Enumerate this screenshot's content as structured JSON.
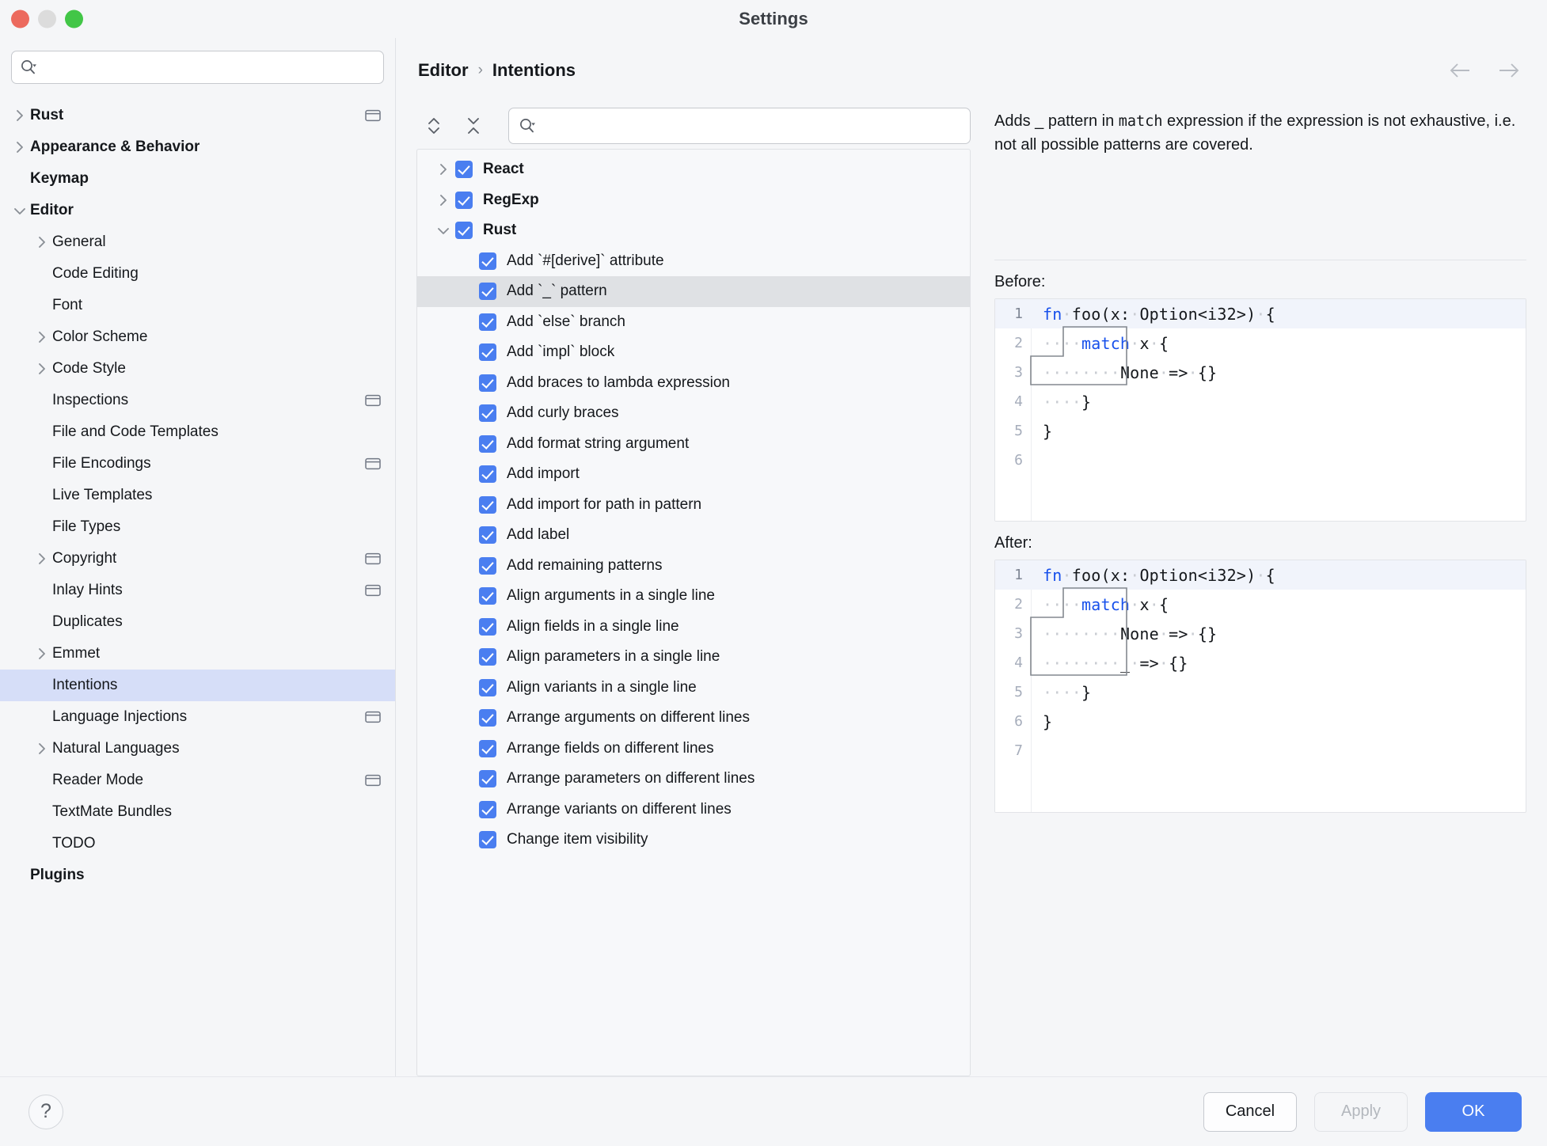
{
  "window": {
    "title": "Settings",
    "traffic_lights": [
      "close",
      "minimize",
      "zoom"
    ]
  },
  "sidebar": {
    "search": {
      "value": "",
      "placeholder": ""
    },
    "items": [
      {
        "label": "Rust",
        "indent": 0,
        "bold": true,
        "chevron": "right",
        "badge": true
      },
      {
        "label": "Appearance & Behavior",
        "indent": 0,
        "bold": true,
        "chevron": "right",
        "badge": false
      },
      {
        "label": "Keymap",
        "indent": 0,
        "bold": true,
        "chevron": "none",
        "badge": false
      },
      {
        "label": "Editor",
        "indent": 0,
        "bold": true,
        "chevron": "down",
        "badge": false
      },
      {
        "label": "General",
        "indent": 1,
        "bold": false,
        "chevron": "right",
        "badge": false
      },
      {
        "label": "Code Editing",
        "indent": 1,
        "bold": false,
        "chevron": "none",
        "badge": false
      },
      {
        "label": "Font",
        "indent": 1,
        "bold": false,
        "chevron": "none",
        "badge": false
      },
      {
        "label": "Color Scheme",
        "indent": 1,
        "bold": false,
        "chevron": "right",
        "badge": false
      },
      {
        "label": "Code Style",
        "indent": 1,
        "bold": false,
        "chevron": "right",
        "badge": false
      },
      {
        "label": "Inspections",
        "indent": 1,
        "bold": false,
        "chevron": "none",
        "badge": true
      },
      {
        "label": "File and Code Templates",
        "indent": 1,
        "bold": false,
        "chevron": "none",
        "badge": false
      },
      {
        "label": "File Encodings",
        "indent": 1,
        "bold": false,
        "chevron": "none",
        "badge": true
      },
      {
        "label": "Live Templates",
        "indent": 1,
        "bold": false,
        "chevron": "none",
        "badge": false
      },
      {
        "label": "File Types",
        "indent": 1,
        "bold": false,
        "chevron": "none",
        "badge": false
      },
      {
        "label": "Copyright",
        "indent": 1,
        "bold": false,
        "chevron": "right",
        "badge": true
      },
      {
        "label": "Inlay Hints",
        "indent": 1,
        "bold": false,
        "chevron": "none",
        "badge": true
      },
      {
        "label": "Duplicates",
        "indent": 1,
        "bold": false,
        "chevron": "none",
        "badge": false
      },
      {
        "label": "Emmet",
        "indent": 1,
        "bold": false,
        "chevron": "right",
        "badge": false
      },
      {
        "label": "Intentions",
        "indent": 1,
        "bold": false,
        "chevron": "none",
        "badge": false,
        "selected": true
      },
      {
        "label": "Language Injections",
        "indent": 1,
        "bold": false,
        "chevron": "none",
        "badge": true
      },
      {
        "label": "Natural Languages",
        "indent": 1,
        "bold": false,
        "chevron": "right",
        "badge": false
      },
      {
        "label": "Reader Mode",
        "indent": 1,
        "bold": false,
        "chevron": "none",
        "badge": true
      },
      {
        "label": "TextMate Bundles",
        "indent": 1,
        "bold": false,
        "chevron": "none",
        "badge": false
      },
      {
        "label": "TODO",
        "indent": 1,
        "bold": false,
        "chevron": "none",
        "badge": false
      },
      {
        "label": "Plugins",
        "indent": 0,
        "bold": true,
        "chevron": "none",
        "badge": false
      }
    ]
  },
  "breadcrumb": {
    "parent": "Editor",
    "separator": "›",
    "current": "Intentions"
  },
  "nav": {
    "back_icon": "arrow-left-icon",
    "forward_icon": "arrow-right-icon"
  },
  "toolbar": {
    "expand_all_icon": "expand-all-icon",
    "collapse_all_icon": "collapse-all-icon",
    "filter": {
      "value": "",
      "placeholder": ""
    }
  },
  "intentions": [
    {
      "label": "React",
      "level": 0,
      "checked": true,
      "chevron": "right",
      "bold": true
    },
    {
      "label": "RegExp",
      "level": 0,
      "checked": true,
      "chevron": "right",
      "bold": true
    },
    {
      "label": "Rust",
      "level": 0,
      "checked": true,
      "chevron": "down",
      "bold": true
    },
    {
      "label": "Add `#[derive]` attribute",
      "level": 1,
      "checked": true,
      "chevron": "none",
      "bold": false
    },
    {
      "label": "Add `_` pattern",
      "level": 1,
      "checked": true,
      "chevron": "none",
      "bold": false,
      "selected": true
    },
    {
      "label": "Add `else` branch",
      "level": 1,
      "checked": true,
      "chevron": "none",
      "bold": false
    },
    {
      "label": "Add `impl` block",
      "level": 1,
      "checked": true,
      "chevron": "none",
      "bold": false
    },
    {
      "label": "Add braces to lambda expression",
      "level": 1,
      "checked": true,
      "chevron": "none",
      "bold": false
    },
    {
      "label": "Add curly braces",
      "level": 1,
      "checked": true,
      "chevron": "none",
      "bold": false
    },
    {
      "label": "Add format string argument",
      "level": 1,
      "checked": true,
      "chevron": "none",
      "bold": false
    },
    {
      "label": "Add import",
      "level": 1,
      "checked": true,
      "chevron": "none",
      "bold": false
    },
    {
      "label": "Add import for path in pattern",
      "level": 1,
      "checked": true,
      "chevron": "none",
      "bold": false
    },
    {
      "label": "Add label",
      "level": 1,
      "checked": true,
      "chevron": "none",
      "bold": false
    },
    {
      "label": "Add remaining patterns",
      "level": 1,
      "checked": true,
      "chevron": "none",
      "bold": false
    },
    {
      "label": "Align arguments in a single line",
      "level": 1,
      "checked": true,
      "chevron": "none",
      "bold": false
    },
    {
      "label": "Align fields in a single line",
      "level": 1,
      "checked": true,
      "chevron": "none",
      "bold": false
    },
    {
      "label": "Align parameters in a single line",
      "level": 1,
      "checked": true,
      "chevron": "none",
      "bold": false
    },
    {
      "label": "Align variants in a single line",
      "level": 1,
      "checked": true,
      "chevron": "none",
      "bold": false
    },
    {
      "label": "Arrange arguments on different lines",
      "level": 1,
      "checked": true,
      "chevron": "none",
      "bold": false
    },
    {
      "label": "Arrange fields on different lines",
      "level": 1,
      "checked": true,
      "chevron": "none",
      "bold": false
    },
    {
      "label": "Arrange parameters on different lines",
      "level": 1,
      "checked": true,
      "chevron": "none",
      "bold": false
    },
    {
      "label": "Arrange variants on different lines",
      "level": 1,
      "checked": true,
      "chevron": "none",
      "bold": false
    },
    {
      "label": "Change item visibility",
      "level": 1,
      "checked": true,
      "chevron": "none",
      "bold": false
    }
  ],
  "detail": {
    "description_part1": "Adds _ pattern in ",
    "description_code": "match",
    "description_part2": " expression if the expression is not exhaustive, i.e. not all possible patterns are covered.",
    "before_label": "Before:",
    "after_label": "After:",
    "before_code": {
      "line_numbers": [
        "1",
        "2",
        "3",
        "4",
        "5",
        "6"
      ],
      "lines": [
        "fn foo(x: Option<i32>) {",
        "    match x {",
        "        None => {}",
        "    }",
        "}",
        ""
      ]
    },
    "after_code": {
      "line_numbers": [
        "1",
        "2",
        "3",
        "4",
        "5",
        "6",
        "7"
      ],
      "lines": [
        "fn foo(x: Option<i32>) {",
        "    match x {",
        "        None => {}",
        "        _ => {}",
        "    }",
        "}",
        ""
      ]
    }
  },
  "footer": {
    "help_label": "?",
    "cancel_label": "Cancel",
    "apply_label": "Apply",
    "ok_label": "OK"
  },
  "colors": {
    "accent": "#4a7ef0",
    "selection": "#d6def8",
    "row_selection": "#dfe1e4",
    "keyword": "#1750eb",
    "background": "#f5f6f8"
  }
}
